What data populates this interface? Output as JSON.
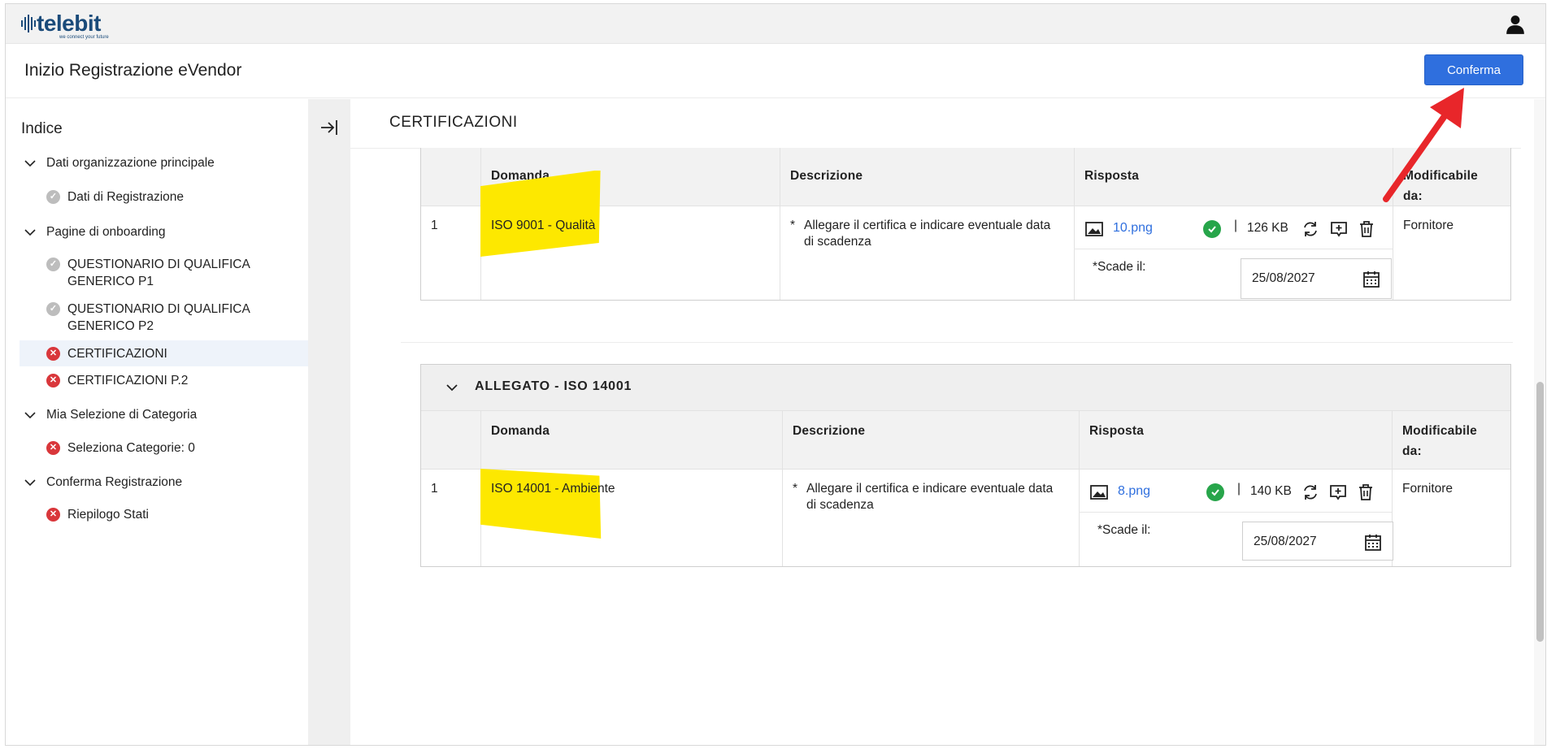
{
  "brand": {
    "name": "telebit",
    "tagline": "we connect your future"
  },
  "header": {
    "title": "Inizio Registrazione eVendor",
    "confirm_label": "Conferma"
  },
  "sidebar": {
    "heading": "Indice",
    "groups": [
      {
        "label": "Dati organizzazione principale",
        "items": [
          {
            "label": "Dati di Registrazione",
            "status": "complete"
          }
        ]
      },
      {
        "label": "Pagine di onboarding",
        "items": [
          {
            "label": "QUESTIONARIO DI QUALIFICA GENERICO P1",
            "line1": "QUESTIONARIO DI QUALIFICA",
            "line2": "GENERICO P1",
            "status": "complete"
          },
          {
            "label": "QUESTIONARIO DI QUALIFICA GENERICO P2",
            "line1": "QUESTIONARIO DI QUALIFICA",
            "line2": "GENERICO P2",
            "status": "complete"
          },
          {
            "label": "CERTIFICAZIONI",
            "status": "error",
            "active": true
          },
          {
            "label": "CERTIFICAZIONI P.2",
            "status": "error"
          }
        ]
      },
      {
        "label": "Mia Selezione di Categoria",
        "items": [
          {
            "label": "Seleziona Categorie: 0",
            "status": "error"
          }
        ]
      },
      {
        "label": "Conferma Registrazione",
        "items": [
          {
            "label": "Riepilogo Stati",
            "status": "error"
          }
        ]
      }
    ]
  },
  "main": {
    "section_title": "CERTIFICAZIONI",
    "columns": {
      "domanda": "Domanda",
      "descrizione": "Descrizione",
      "risposta": "Risposta",
      "modificabile_l1": "Modificabile",
      "modificabile_l2": "da:"
    },
    "tables": [
      {
        "group_title": "",
        "rows": [
          {
            "index": "1",
            "domanda": "ISO 9001 - Qualità",
            "descrizione_l1": "Allegare il certifica e indicare eventuale data",
            "descrizione_l2": "di scadenza",
            "required_mark": "*",
            "file_name": "10.png",
            "file_size": "126 KB",
            "separator": "|",
            "scade_label": "*Scade il:",
            "scade_date": "25/08/2027",
            "modificabile": "Fornitore"
          }
        ]
      },
      {
        "group_title": "ALLEGATO - ISO 14001",
        "rows": [
          {
            "index": "1",
            "domanda": "ISO 14001 - Ambiente",
            "descrizione_l1": "Allegare il certifica e indicare eventuale data",
            "descrizione_l2": "di scadenza",
            "required_mark": "*",
            "file_name": "8.png",
            "file_size": "140 KB",
            "separator": "|",
            "scade_label": "*Scade il:",
            "scade_date": "25/08/2027",
            "modificabile": "Fornitore"
          }
        ]
      }
    ]
  },
  "colors": {
    "accent": "#2f6fde",
    "highlight": "#fde800",
    "error": "#d9373b",
    "success": "#27a54a",
    "annotation_arrow": "#e8262a"
  },
  "icons": [
    "user-icon",
    "collapse-panel-icon",
    "chevron-down-icon",
    "image-file-icon",
    "check-circle-icon",
    "replace-icon",
    "add-comment-icon",
    "trash-icon",
    "calendar-icon"
  ]
}
